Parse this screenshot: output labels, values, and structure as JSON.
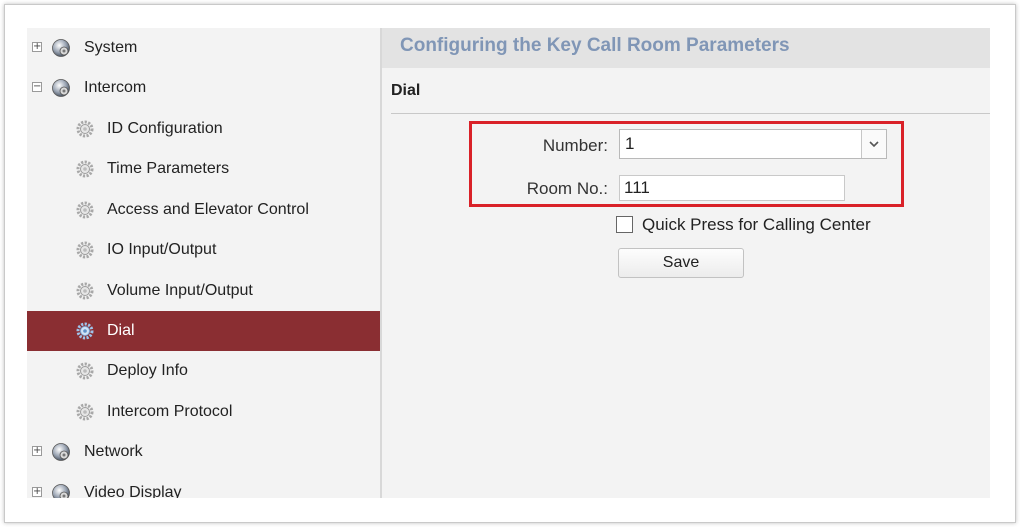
{
  "sidebar": {
    "items": [
      {
        "label": "System",
        "expander": "+"
      },
      {
        "label": "Intercom",
        "expander": "−"
      },
      {
        "label": "ID Configuration"
      },
      {
        "label": "Time Parameters"
      },
      {
        "label": "Access and Elevator Control"
      },
      {
        "label": "IO Input/Output"
      },
      {
        "label": "Volume Input/Output"
      },
      {
        "label": "Dial",
        "active": true
      },
      {
        "label": "Deploy Info"
      },
      {
        "label": "Intercom Protocol"
      },
      {
        "label": "Network",
        "expander": "+"
      },
      {
        "label": "Video Display",
        "expander": "+"
      }
    ]
  },
  "main": {
    "title": "Configuring the Key Call Room Parameters",
    "section": "Dial",
    "number_label": "Number:",
    "number_value": "1",
    "room_label": "Room No.:",
    "room_value": "111",
    "quick_press_label": "Quick Press for Calling Center",
    "quick_press_checked": false,
    "save_label": "Save"
  },
  "colors": {
    "active_item": "#8a2e32",
    "title_text": "#8096b6",
    "highlight_border": "#d92128"
  }
}
